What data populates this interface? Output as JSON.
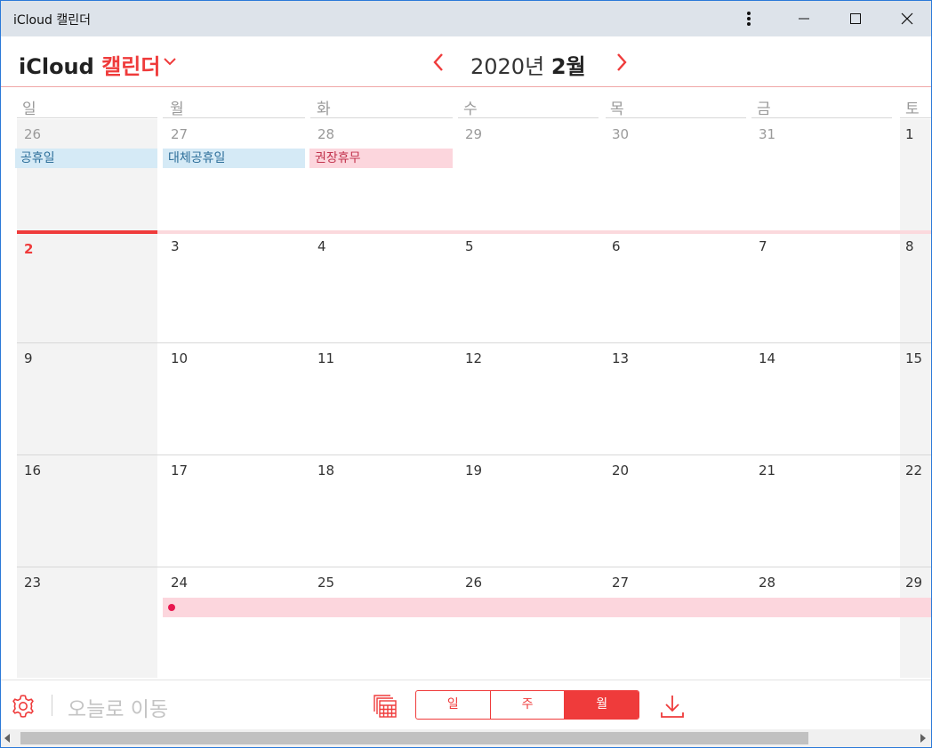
{
  "window": {
    "title": "iCloud 캘린더"
  },
  "header": {
    "brand_icloud": "iCloud",
    "brand_calendar": "캘린더",
    "year_text": "2020년",
    "month_text": "2월"
  },
  "weekdays": [
    "일",
    "월",
    "화",
    "수",
    "목",
    "금",
    "토"
  ],
  "weeks": [
    [
      "26",
      "27",
      "28",
      "29",
      "30",
      "31",
      "1"
    ],
    [
      "2",
      "3",
      "4",
      "5",
      "6",
      "7",
      "8"
    ],
    [
      "9",
      "10",
      "11",
      "12",
      "13",
      "14",
      "15"
    ],
    [
      "16",
      "17",
      "18",
      "19",
      "20",
      "21",
      "22"
    ],
    [
      "23",
      "24",
      "25",
      "26",
      "27",
      "28",
      "29"
    ]
  ],
  "events": {
    "holiday": "공휴일",
    "substitute_holiday": "대체공휴일",
    "recommended_leave": "권장휴무"
  },
  "footer": {
    "go_today": "오늘로 이동",
    "view_day": "일",
    "view_week": "주",
    "view_month": "월",
    "active_view": "월"
  },
  "colors": {
    "accent": "#ef3b3b",
    "event_blue": "#d5eaf6",
    "event_pink": "#fcd6dd",
    "event_dot": "#e8174f"
  },
  "icons": {
    "more": "more-vertical-icon",
    "minimize": "minimize-icon",
    "maximize": "maximize-icon",
    "close": "close-icon",
    "dropdown": "chevron-down-icon",
    "prev": "chevron-left-icon",
    "next": "chevron-right-icon",
    "settings": "gear-icon",
    "calendars": "calendar-stack-icon",
    "download": "download-icon"
  }
}
